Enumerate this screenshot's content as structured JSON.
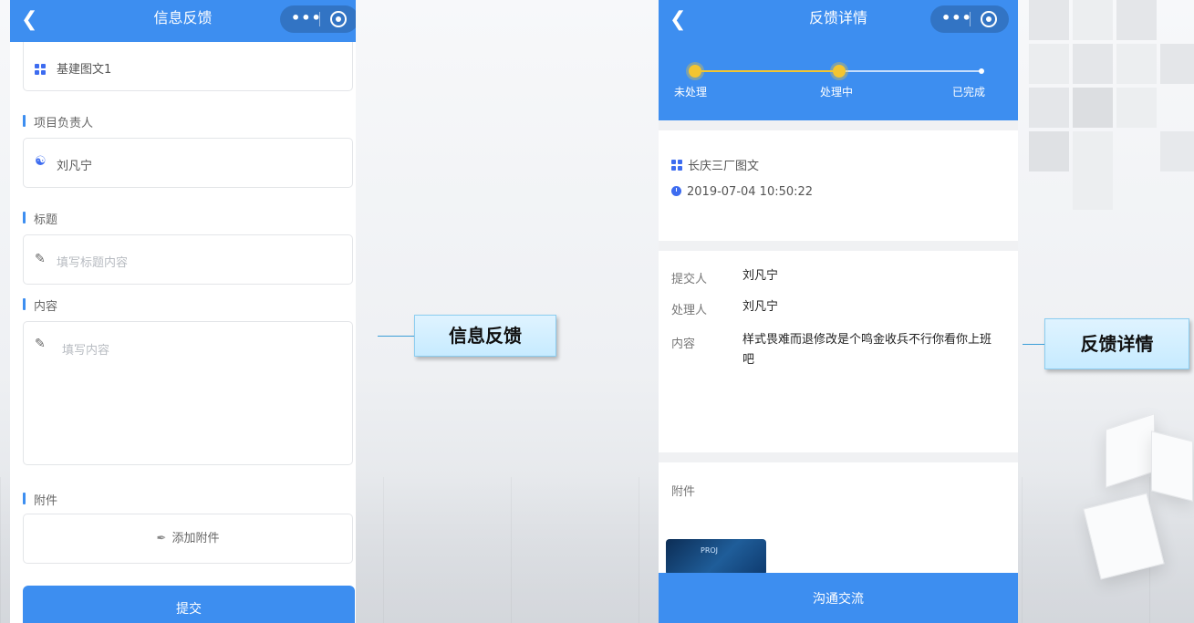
{
  "left_phone": {
    "nav_title": "信息反馈",
    "project": "基建图文1",
    "manager_label": "项目负责人",
    "manager_value": "刘凡宁",
    "title_label": "标题",
    "title_placeholder": "填写标题内容",
    "content_label": "内容",
    "content_placeholder": "填写内容",
    "attachment_label": "附件",
    "add_attachment": "添加附件",
    "submit": "提交"
  },
  "right_phone": {
    "nav_title": "反馈详情",
    "stages": [
      "未处理",
      "处理中",
      "已完成"
    ],
    "project": "长庆三厂图文",
    "datetime": "2019-07-04 10:50:22",
    "submitter_label": "提交人",
    "submitter_value": "刘凡宁",
    "handler_label": "处理人",
    "handler_value": "刘凡宁",
    "content_label": "内容",
    "content_value": "样式畏难而退修改是个鸣金收兵不行你看你上班吧",
    "attachment_label": "附件",
    "thumb_text": "PROJ",
    "bottom_button": "沟通交流"
  },
  "callouts": {
    "left": "信息反馈",
    "right": "反馈详情"
  },
  "colors": {
    "primary": "#3d8ef0",
    "progress_node": "#f3c531"
  }
}
